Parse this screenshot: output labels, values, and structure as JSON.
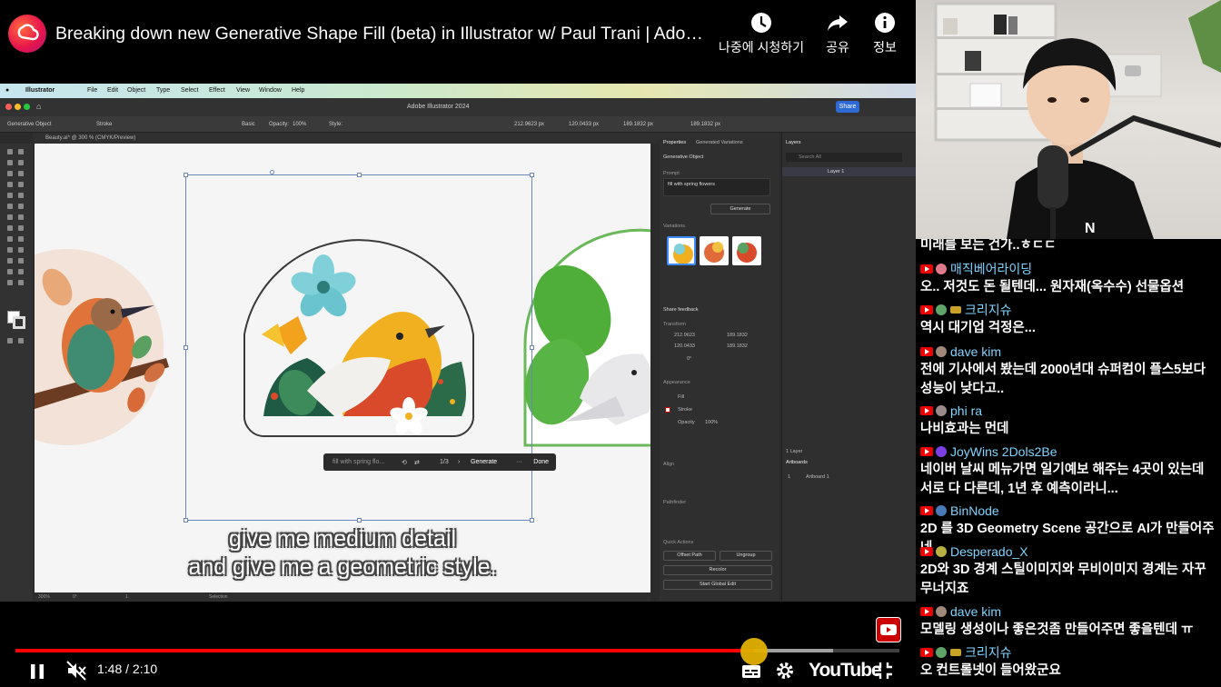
{
  "video": {
    "title": "Breaking down new Generative Shape Fill (beta) in Illustrator w/ Paul Trani | Adobe C...",
    "actions": {
      "watch_later": "나중에 시청하기",
      "share": "공유",
      "info": "정보"
    }
  },
  "illustrator": {
    "menu": [
      "Illustrator",
      "File",
      "Edit",
      "Object",
      "Type",
      "Select",
      "Effect",
      "View",
      "Window",
      "Help"
    ],
    "window_title": "Adobe Illustrator 2024",
    "share": "Share",
    "control_bar": {
      "object_type": "Generative Object",
      "stroke": "Stroke",
      "stroke_style": "Basic",
      "opacity_label": "Opacity:",
      "opacity": "100%",
      "style_label": "Style:",
      "x": "212.9623 px",
      "y": "120.0433 px",
      "w": "189.1832 px",
      "h": "189.1832 px"
    },
    "doc_tab": "Beauty.ai* @ 300 % (CMYK/Preview)",
    "float_bar": {
      "prompt": "fill with spring flo...",
      "page": "1/3",
      "generate": "Generate",
      "done": "Done"
    },
    "status": {
      "zoom": "300%",
      "rotation": "0°",
      "artboard": "1",
      "tool": "Selection"
    },
    "properties": {
      "tabs": [
        "Properties",
        "Generated Variations"
      ],
      "object": "Generative Object",
      "prompt_label": "Prompt",
      "prompt_value": "fill with spring flowers",
      "generate": "Generate",
      "variations": "Variations",
      "share_feedback": "Share feedback",
      "transform": "Transform",
      "x": "212.9623",
      "y": "120.0433",
      "w": "189.1832",
      "h": "189.1832",
      "angle": "0°",
      "appearance": "Appearance",
      "fill": "Fill",
      "stroke": "Stroke",
      "opacity": "Opacity",
      "opacity_value": "100%",
      "align": "Align",
      "pathfinder": "Pathfinder",
      "quick_actions": "Quick Actions",
      "offset_path": "Offset Path",
      "ungroup": "Ungroup",
      "recolor": "Recolor",
      "start_global_edit": "Start Global Edit"
    },
    "layers": {
      "tab": "Layers",
      "search": "Search All",
      "layer": "Layer 1",
      "count": "1 Layer",
      "artboards_tab": "Artboards",
      "artboard_num": "1",
      "artboard_name": "Artboard 1"
    }
  },
  "subtitles": [
    "give me medium detail",
    "and give me a geometric style."
  ],
  "player": {
    "time": "1:48 / 2:10",
    "progress": 0.836,
    "buffered": 0.925,
    "brand": "YouTube"
  },
  "chat": {
    "messages": [
      {
        "author": "",
        "text": "미래를 보는 건가..ㅎㄷㄷ",
        "author_color": "#ffffff",
        "avatar": "#888888"
      },
      {
        "author": "매직베어라이딩",
        "text": "오.. 저것도 돈 될텐데... 원자재(옥수수) 선물옵션",
        "author_color": "#7fd4ff",
        "avatar": "#e07a8a"
      },
      {
        "author": "크리지슈",
        "text": "역시 대기업 걱정은...",
        "author_color": "#7fd4ff",
        "avatar": "#5fa56a"
      },
      {
        "author": "dave kim",
        "text": "전에 기사에서 봤는데 2000년대 슈퍼컴이 플스5보다 성능이 낮다고..",
        "author_color": "#7fd4ff",
        "avatar": "#a0887a"
      },
      {
        "author": "phi ra",
        "text": "나비효과는 먼데",
        "author_color": "#7fd4ff",
        "avatar": "#9a8a8a"
      },
      {
        "author": "JoyWins 2Dols2Be",
        "text": "네이버 날씨 메뉴가면 일기예보 해주는 4곳이 있는데 서로 다 다른데, 1년 후 예측이라니...",
        "author_color": "#7fd4ff",
        "avatar": "#7b3fe4"
      },
      {
        "author": "BinNode",
        "text": "2D 를 3D Geometry Scene 공간으로 AI가 만들어주네",
        "author_color": "#7fd4ff",
        "avatar": "#4a7ab8"
      },
      {
        "author": "Desperado_X",
        "text": "2D와 3D 경계 스틸이미지와 무비이미지 경계는 자꾸 무너지죠",
        "author_color": "#7fd4ff",
        "avatar": "#b8b040"
      },
      {
        "author": "dave kim",
        "text": "모델링 생성이나 좋은것좀 만들어주면 좋을텐데 ㅠ",
        "author_color": "#7fd4ff",
        "avatar": "#a0887a"
      },
      {
        "author": "크리지슈",
        "text": "오 컨트롤넷이 들어왔군요",
        "author_color": "#7fd4ff",
        "avatar": "#5fa56a"
      }
    ]
  }
}
